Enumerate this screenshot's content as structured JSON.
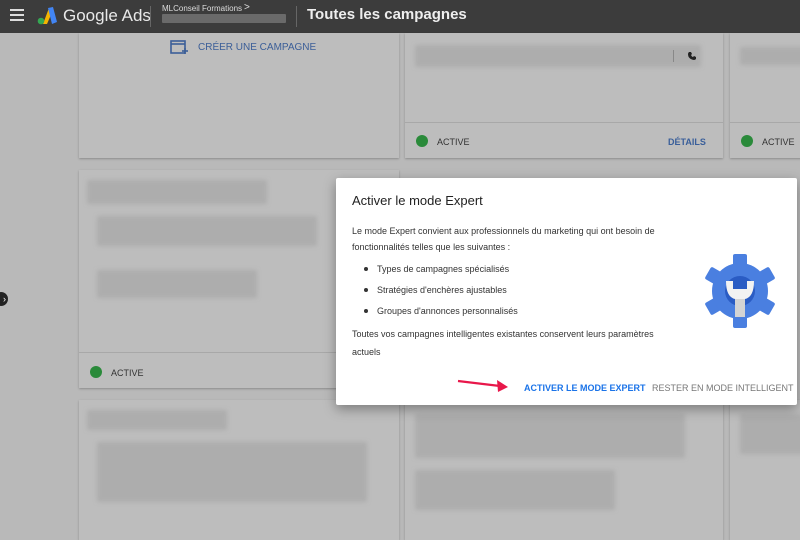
{
  "header": {
    "brand": "Google Ads",
    "account_name": "MLConseil Formations",
    "account_chevron": ">",
    "page_title": "Toutes les campagnes"
  },
  "create_card": {
    "label": "CRÉER UNE CAMPAGNE"
  },
  "cards": {
    "status_active": "ACTIVE",
    "details_link": "DÉTAILS"
  },
  "dialog": {
    "title": "Activer le mode Expert",
    "intro": "Le mode Expert convient aux professionnels du marketing qui ont besoin de fonctionnalités telles que les suivantes :",
    "features": [
      "Types de campagnes spécialisés",
      "Stratégies d'enchères ajustables",
      "Groupes d'annonces personnalisés"
    ],
    "outro": "Toutes vos campagnes intelligentes existantes conservent leurs paramètres actuels",
    "primary_button": "ACTIVER LE MODE EXPERT",
    "secondary_button": "RESTER EN MODE INTELLIGENT"
  },
  "colors": {
    "accent": "#1a73e8",
    "active_status": "#2a8a3a",
    "annotation_arrow": "#e8174a",
    "topbar": "#3c3c3c"
  }
}
